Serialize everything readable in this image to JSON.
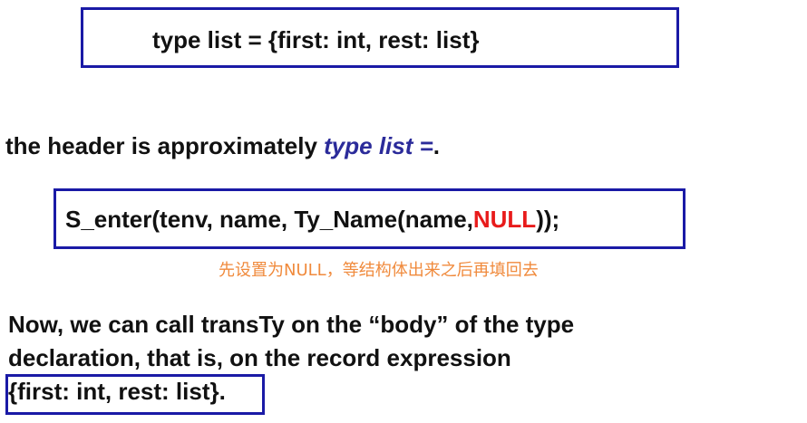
{
  "slide": {
    "box1_code": "type list = {first: int, rest: list}",
    "header_prefix": "the header is approximately ",
    "header_emph": "type list =",
    "header_suffix": ".",
    "box2_code_prefix": "S_enter(tenv, name, Ty_Name(name,",
    "box2_code_null": "NULL",
    "box2_code_suffix": "));",
    "chinese_note": "先设置为NULL，等结构体出来之后再填回去",
    "paragraph_line1": "Now, we can call transTy on the “body” of the type",
    "paragraph_line2": "declaration, that is, on the record expression",
    "paragraph_line3": "{first: int, rest: list}."
  },
  "colors": {
    "box_border": "#1a1aa6",
    "emphasis": "#2b2b9a",
    "null_highlight": "#e81b1b",
    "note": "#f08a3c"
  }
}
